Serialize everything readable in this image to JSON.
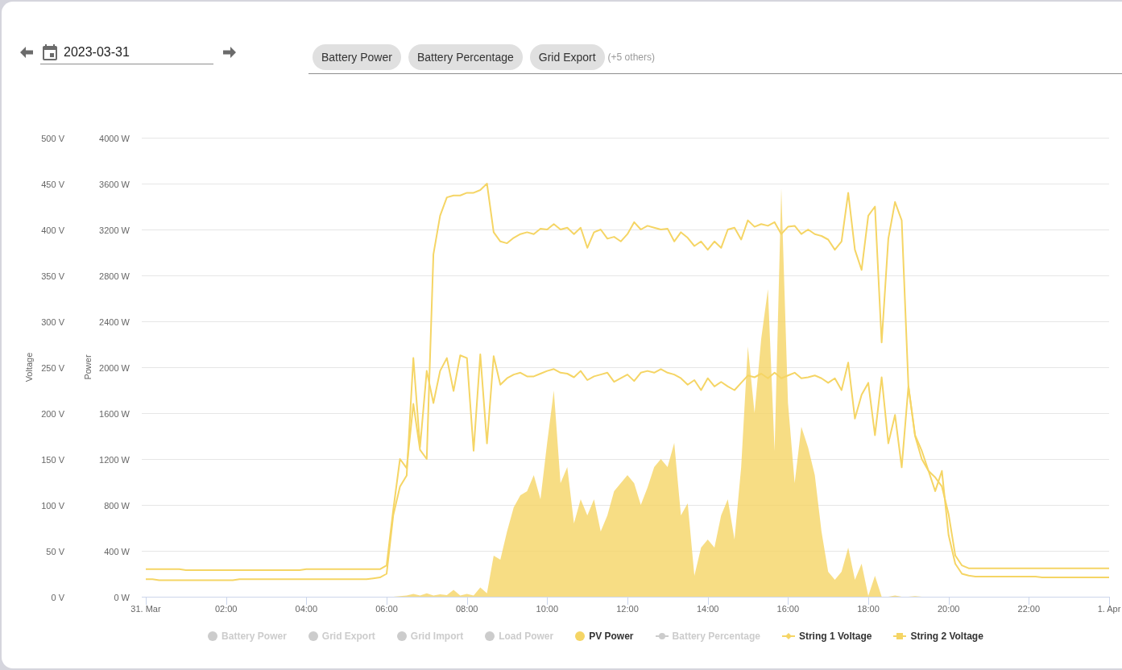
{
  "toolbar": {
    "date_field": {
      "value": "2023-03-31"
    },
    "series_select": {
      "chips": [
        "Battery Power",
        "Battery Percentage",
        "Grid Export"
      ],
      "more": "(+5 others)"
    }
  },
  "chart": {
    "chart_data": {
      "type": "line",
      "grid": true,
      "x": [
        0,
        10,
        20,
        30,
        40,
        50,
        60,
        70,
        80,
        90,
        100,
        110,
        120,
        130,
        140,
        150,
        160,
        170,
        180,
        190,
        200,
        210,
        220,
        230,
        240,
        250,
        260,
        270,
        280,
        290,
        300,
        310,
        320,
        330,
        340,
        350,
        360,
        370,
        380,
        390,
        400,
        410,
        420,
        430,
        440,
        450,
        460,
        470,
        480,
        490,
        500,
        510,
        520,
        530,
        540,
        550,
        560,
        570,
        580,
        590,
        600,
        610,
        620,
        630,
        640,
        650,
        660,
        670,
        680,
        690,
        700,
        710,
        720,
        730,
        740,
        750,
        760,
        770,
        780,
        790,
        800,
        810,
        820,
        830,
        840,
        850,
        860,
        870,
        880,
        890,
        900,
        910,
        920,
        930,
        940,
        950,
        960,
        970,
        980,
        990,
        1000,
        1010,
        1020,
        1030,
        1040,
        1050,
        1060,
        1070,
        1080,
        1090,
        1100,
        1110,
        1120,
        1130,
        1140,
        1150,
        1160,
        1170,
        1180,
        1190,
        1200,
        1210,
        1220,
        1230,
        1240,
        1250,
        1260,
        1270,
        1280,
        1290,
        1300,
        1310,
        1320,
        1330,
        1340,
        1350,
        1360,
        1370,
        1380,
        1390,
        1400,
        1410,
        1420,
        1430,
        1440
      ],
      "xlim": [
        0,
        1440
      ],
      "xticks": [
        {
          "value": 0,
          "label": "31. Mar"
        },
        {
          "value": 120,
          "label": "02:00"
        },
        {
          "value": 240,
          "label": "04:00"
        },
        {
          "value": 360,
          "label": "06:00"
        },
        {
          "value": 480,
          "label": "08:00"
        },
        {
          "value": 600,
          "label": "10:00"
        },
        {
          "value": 720,
          "label": "12:00"
        },
        {
          "value": 840,
          "label": "14:00"
        },
        {
          "value": 960,
          "label": "16:00"
        },
        {
          "value": 1080,
          "label": "18:00"
        },
        {
          "value": 1200,
          "label": "20:00"
        },
        {
          "value": 1320,
          "label": "22:00"
        },
        {
          "value": 1440,
          "label": "1. Apr"
        }
      ],
      "ylabel": "Voltage",
      "ylim": [
        0,
        500
      ],
      "yticks": [
        {
          "value": 0,
          "label": "0 V"
        },
        {
          "value": 50,
          "label": "50 V"
        },
        {
          "value": 100,
          "label": "100 V"
        },
        {
          "value": 150,
          "label": "150 V"
        },
        {
          "value": 200,
          "label": "200 V"
        },
        {
          "value": 250,
          "label": "250 V"
        },
        {
          "value": 300,
          "label": "300 V"
        },
        {
          "value": 350,
          "label": "350 V"
        },
        {
          "value": 400,
          "label": "400 V"
        },
        {
          "value": 450,
          "label": "450 V"
        },
        {
          "value": 500,
          "label": "500 V"
        }
      ],
      "y2label": "Power",
      "y2lim": [
        0,
        4000
      ],
      "y2ticks": [
        {
          "value": 0,
          "label": "0 W"
        },
        {
          "value": 400,
          "label": "400 W"
        },
        {
          "value": 800,
          "label": "800 W"
        },
        {
          "value": 1200,
          "label": "1200 W"
        },
        {
          "value": 1600,
          "label": "1600 W"
        },
        {
          "value": 2000,
          "label": "2000 W"
        },
        {
          "value": 2400,
          "label": "2400 W"
        },
        {
          "value": 2800,
          "label": "2800 W"
        },
        {
          "value": 3200,
          "label": "3200 W"
        },
        {
          "value": 3600,
          "label": "3600 W"
        },
        {
          "value": 4000,
          "label": "4000 W"
        }
      ],
      "series": [
        {
          "name": "PV Power",
          "type": "area",
          "axis": "y2",
          "color": "#f5d565",
          "values": [
            0,
            0,
            0,
            0,
            0,
            0,
            0,
            0,
            0,
            0,
            0,
            0,
            0,
            0,
            0,
            0,
            0,
            0,
            0,
            0,
            0,
            0,
            0,
            0,
            0,
            0,
            0,
            0,
            0,
            0,
            0,
            0,
            0,
            0,
            0,
            0,
            0,
            0,
            5,
            10,
            25,
            10,
            30,
            10,
            20,
            15,
            60,
            10,
            25,
            10,
            80,
            30,
            358,
            323,
            568,
            779,
            884,
            919,
            1060,
            849,
            1340,
            1797,
            990,
            1130,
            639,
            849,
            709,
            849,
            568,
            709,
            919,
            990,
            1060,
            990,
            800,
            950,
            1130,
            1200,
            1130,
            1340,
            709,
            814,
            182,
            428,
            498,
            428,
            709,
            849,
            498,
            1130,
            2180,
            1600,
            2250,
            2680,
            1270,
            3560,
            1690,
            990,
            1480,
            1300,
            1060,
            568,
            218,
            147,
            218,
            428,
            147,
            288,
            7,
            182,
            0,
            0,
            10,
            0,
            0,
            5,
            0,
            0,
            0,
            0,
            0,
            0,
            0,
            0,
            0,
            0,
            0,
            0,
            0,
            0,
            0,
            0,
            0,
            0,
            0,
            0,
            0,
            0,
            0,
            0,
            0,
            0,
            0,
            0,
            0
          ]
        },
        {
          "name": "String 1 Voltage",
          "type": "line",
          "axis": "y",
          "color": "#f5d565",
          "values": [
            30,
            30,
            30,
            30,
            30,
            30,
            29,
            29,
            29,
            29,
            29,
            29,
            29,
            29,
            29,
            29,
            29,
            29,
            29,
            29,
            29,
            29,
            29,
            29,
            30,
            30,
            30,
            30,
            30,
            30,
            30,
            30,
            30,
            30,
            30,
            30,
            34,
            95,
            150,
            140,
            210,
            160,
            150,
            373,
            415,
            435,
            437,
            437,
            440,
            440,
            443,
            450,
            397,
            387,
            385,
            391,
            395,
            397,
            395,
            401,
            400,
            406,
            400,
            402,
            395,
            402,
            380,
            397,
            400,
            390,
            392,
            387,
            395,
            408,
            400,
            404,
            402,
            400,
            401,
            387,
            397,
            391,
            382,
            387,
            378,
            387,
            380,
            400,
            402,
            389,
            410,
            403,
            406,
            404,
            408,
            395,
            403,
            404,
            395,
            400,
            395,
            393,
            389,
            378,
            387,
            440,
            378,
            356,
            415,
            425,
            277,
            390,
            430,
            410,
            230,
            175,
            150,
            137,
            130,
            120,
            90,
            45,
            34,
            31,
            31,
            31,
            31,
            31,
            31,
            31,
            31,
            31,
            31,
            31,
            31,
            31,
            31,
            31,
            31,
            31,
            31,
            31,
            31,
            31,
            31
          ]
        },
        {
          "name": "String 2 Voltage",
          "type": "line",
          "axis": "y",
          "color": "#f5d565",
          "values": [
            19,
            19,
            18,
            18,
            18,
            18,
            18,
            18,
            18,
            18,
            18,
            18,
            18,
            18,
            19,
            19,
            19,
            19,
            19,
            19,
            19,
            19,
            19,
            19,
            19,
            19,
            19,
            19,
            19,
            19,
            19,
            19,
            19,
            19,
            20,
            21,
            25,
            89,
            120,
            132,
            260,
            163,
            246,
            211,
            246,
            260,
            224,
            263,
            260,
            159,
            264,
            167,
            262,
            231,
            238,
            242,
            244,
            240,
            240,
            243,
            246,
            248,
            244,
            243,
            239,
            246,
            236,
            240,
            242,
            244,
            234,
            238,
            242,
            235,
            244,
            246,
            244,
            248,
            244,
            242,
            238,
            231,
            236,
            225,
            238,
            229,
            234,
            229,
            225,
            233,
            241,
            239,
            243,
            238,
            244,
            238,
            241,
            244,
            238,
            239,
            241,
            238,
            233,
            238,
            225,
            255,
            194,
            220,
            233,
            176,
            239,
            167,
            198,
            141,
            229,
            176,
            159,
            137,
            115,
            137,
            67,
            36,
            25,
            23,
            22,
            22,
            22,
            22,
            22,
            22,
            22,
            22,
            22,
            22,
            21,
            21,
            21,
            21,
            21,
            21,
            21,
            21,
            21,
            21,
            21
          ]
        }
      ]
    },
    "legend": [
      {
        "label": "Battery Power",
        "visible": false,
        "kind": "dot"
      },
      {
        "label": "Grid Export",
        "visible": false,
        "kind": "dot"
      },
      {
        "label": "Grid Import",
        "visible": false,
        "kind": "dot"
      },
      {
        "label": "Load Power",
        "visible": false,
        "kind": "dot"
      },
      {
        "visible": true,
        "kind": "dot"
      },
      {
        "label": "Battery Percentage",
        "visible": false,
        "kind": "line-circle"
      },
      {
        "visible": true,
        "kind": "line-diamond"
      },
      {
        "visible": true,
        "kind": "line-square"
      }
    ]
  }
}
